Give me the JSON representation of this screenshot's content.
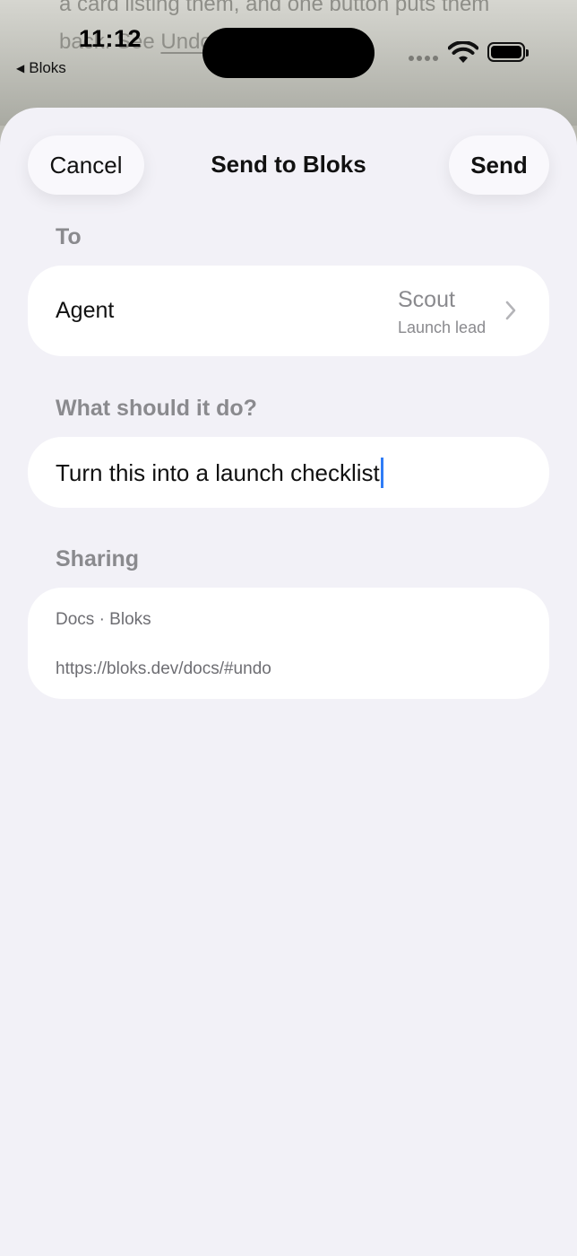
{
  "background": {
    "line1": "a card listing them, and one button puts them",
    "line2_prefix": "back. See ",
    "line2_link": "Undo"
  },
  "status_bar": {
    "time": "11:12",
    "back_label": "Bloks"
  },
  "sheet": {
    "title": "Send to Bloks",
    "cancel_label": "Cancel",
    "send_label": "Send"
  },
  "to": {
    "section_label": "To",
    "field_label": "Agent",
    "agent_name": "Scout",
    "agent_role": "Launch lead"
  },
  "task": {
    "section_label": "What should it do?",
    "value": "Turn this into a launch checklist"
  },
  "sharing": {
    "section_label": "Sharing",
    "title": "Docs · Bloks",
    "url": "https://bloks.dev/docs/#undo"
  },
  "colors": {
    "sheet_background": "#f2f1f7",
    "card_background": "#ffffff",
    "secondary_text": "#8a8a8e",
    "caret": "#2f7cf6"
  },
  "icons": [
    "back-triangle-icon",
    "wifi-icon",
    "battery-icon",
    "chevron-right-icon"
  ]
}
